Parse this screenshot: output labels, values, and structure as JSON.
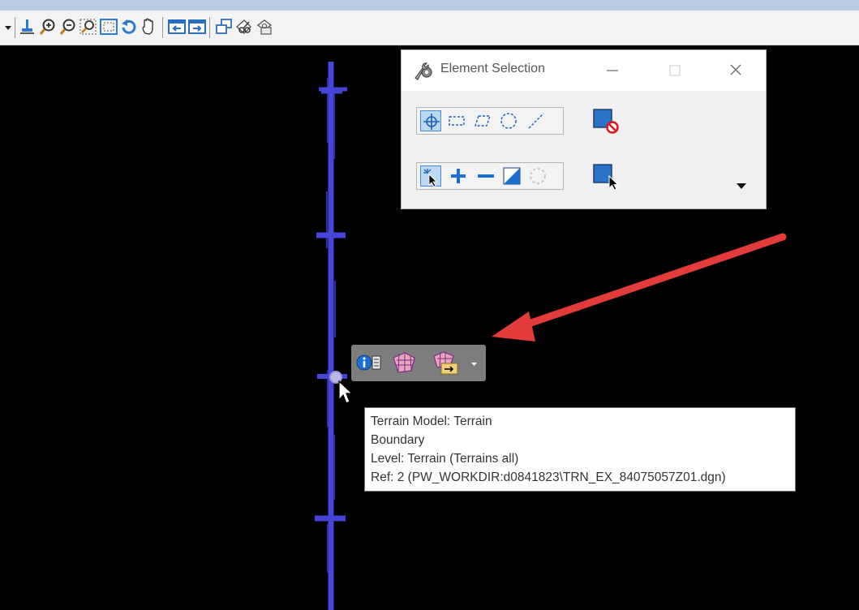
{
  "dialog": {
    "title": "Element Selection",
    "icon": "wrench-gear-icon"
  },
  "tooltip": {
    "lines": [
      "Terrain Model: Terrain",
      "Boundary",
      "Level: Terrain (Terrains all)",
      "Ref: 2 (PW_WORKDIR:d0841823\\TRN_EX_84075057Z01.dgn)"
    ]
  },
  "toolbar": {
    "icons": [
      "dropdown-arrow-icon",
      "update-view-icon",
      "zoom-in-icon",
      "zoom-out-icon",
      "window-area-icon",
      "fit-view-icon",
      "rotate-view-icon",
      "pan-view-icon",
      "view-previous-icon",
      "view-next-icon",
      "copy-view-icon",
      "clip-volume-icon",
      "clip-mask-icon"
    ]
  },
  "colors": {
    "accent": "#4a8bd1",
    "element_line": "#4a4ae0",
    "annotation_arrow": "#e33a3a",
    "canvas": "#000000"
  }
}
